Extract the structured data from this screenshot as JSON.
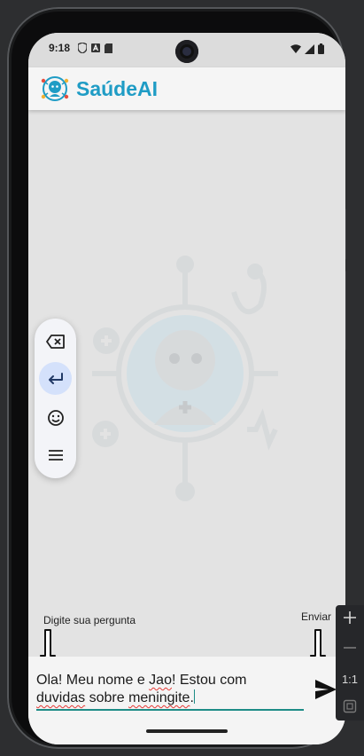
{
  "status_bar": {
    "time": "9:18",
    "left_icons": [
      "shield-icon",
      "font-a-icon",
      "sd-card-icon"
    ],
    "right_icons": [
      "wifi-icon",
      "signal-icon",
      "battery-icon"
    ]
  },
  "app": {
    "title": "SaúdeAI",
    "brand_color": "#1f9cc5",
    "logo_icon": "robot-health-icon"
  },
  "keyboard_toolbar": {
    "buttons": [
      "backspace-icon",
      "enter-icon",
      "emoji-icon",
      "menu-icon"
    ],
    "active_button": "enter-icon"
  },
  "hints": {
    "left": "Digite sua pergunta",
    "right": "Enviar"
  },
  "input": {
    "line1_plain": "Ola! Meu nome e ",
    "line1_misspelled": "Jao",
    "line1_rest": "! Estou com",
    "line2_misspelled1": "duvidas",
    "line2_plain": " sobre ",
    "line2_misspelled2": "meningite",
    "line2_end": ".",
    "accent_color": "#1d8c87"
  },
  "send_button": {
    "icon": "send-icon"
  },
  "emulator_panel": {
    "ratio_label": "1:1",
    "items": [
      "zoom-in-icon",
      "zoom-out-icon",
      "ratio-label",
      "fit-screen-icon"
    ]
  }
}
